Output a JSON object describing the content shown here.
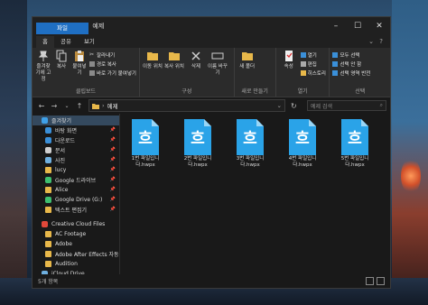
{
  "window": {
    "title": "예제"
  },
  "tabs": [
    {
      "label": "파일",
      "kind": "file"
    },
    {
      "label": "홈",
      "kind": "home"
    },
    {
      "label": "공유",
      "kind": ""
    },
    {
      "label": "보기",
      "kind": ""
    }
  ],
  "ribbon": {
    "clipboard": {
      "pin_label": "즐겨찾기에 고정",
      "copy_label": "복사",
      "paste_label": "붙여넣기",
      "cut_label": "잘라내기",
      "copy_path_label": "경로 복사",
      "paste_shortcut_label": "바로 가기 붙여넣기",
      "group_label": "클립보드"
    },
    "organize": {
      "move_label": "이동 위치",
      "copy_to_label": "복사 위치",
      "delete_label": "삭제",
      "rename_label": "이름 바꾸기",
      "group_label": "구성"
    },
    "new": {
      "new_folder_label": "새 폴더",
      "group_label": "새로 만들기"
    },
    "open": {
      "properties_label": "속성",
      "open_label": "열기",
      "edit_label": "편집",
      "history_label": "히스토리",
      "group_label": "열기"
    },
    "select": {
      "select_all_label": "모두 선택",
      "select_none_label": "선택 안 함",
      "invert_label": "선택 영역 반전",
      "group_label": "선택"
    }
  },
  "address": {
    "path": "예제",
    "search_placeholder": "예제 검색"
  },
  "sidebar": {
    "items": [
      {
        "label": "즐겨찾기",
        "icon": "star-icon",
        "color": "#3fa0e8",
        "pinned": false,
        "selected": true
      },
      {
        "label": "바탕 화면",
        "icon": "desktop-icon",
        "color": "#3a8fd8",
        "pinned": true,
        "selected": false
      },
      {
        "label": "다운로드",
        "icon": "download-icon",
        "color": "#3a8fd8",
        "pinned": true,
        "selected": false
      },
      {
        "label": "문서",
        "icon": "document-icon",
        "color": "#cfcfcf",
        "pinned": true,
        "selected": false
      },
      {
        "label": "사진",
        "icon": "picture-icon",
        "color": "#6fb0e0",
        "pinned": true,
        "selected": false
      },
      {
        "label": "lucy",
        "icon": "folder-icon",
        "color": "#e8b84a",
        "pinned": true,
        "selected": false
      },
      {
        "label": "Google 드라이브",
        "icon": "google-drive-icon",
        "color": "#3fbf6f",
        "pinned": true,
        "selected": false
      },
      {
        "label": "Alice",
        "icon": "folder-icon",
        "color": "#e8b84a",
        "pinned": true,
        "selected": false
      },
      {
        "label": "Google Drive (G:)",
        "icon": "drive-icon",
        "color": "#3fbf6f",
        "pinned": true,
        "selected": false
      },
      {
        "label": "텍스트 편집기",
        "icon": "folder-icon",
        "color": "#e8b84a",
        "pinned": true,
        "selected": false
      },
      {
        "label": "",
        "icon": "",
        "color": "",
        "pinned": false,
        "selected": false
      },
      {
        "label": "Creative Cloud Files",
        "icon": "creative-cloud-icon",
        "color": "#e2483a",
        "pinned": false,
        "selected": false
      },
      {
        "label": "AC Footage",
        "icon": "folder-icon",
        "color": "#e8b84a",
        "pinned": false,
        "selected": false
      },
      {
        "label": "Adobe",
        "icon": "folder-icon",
        "color": "#e8b84a",
        "pinned": false,
        "selected": false
      },
      {
        "label": "Adobe After Effects 자동",
        "icon": "folder-icon",
        "color": "#e8b84a",
        "pinned": false,
        "selected": false
      },
      {
        "label": "Audition",
        "icon": "folder-icon",
        "color": "#e8b84a",
        "pinned": false,
        "selected": false
      },
      {
        "label": "iCloud Drive",
        "icon": "cloud-icon",
        "color": "#6fb0e0",
        "pinned": false,
        "selected": false
      }
    ]
  },
  "files": [
    {
      "name": "1번 파일입니다.hwpx",
      "glyph": "흐"
    },
    {
      "name": "2번 파일입니다.hwpx",
      "glyph": "흐"
    },
    {
      "name": "3번 파일입니다.hwpx",
      "glyph": "흐"
    },
    {
      "name": "4번 파일입니다.hwpx",
      "glyph": "흐"
    },
    {
      "name": "5번 파일입니다.hwpx",
      "glyph": "흐"
    }
  ],
  "status": {
    "count_text": "5개 항목"
  },
  "colors": {
    "accent": "#1f6fc3",
    "hwp_icon": "#2aa3e8"
  }
}
